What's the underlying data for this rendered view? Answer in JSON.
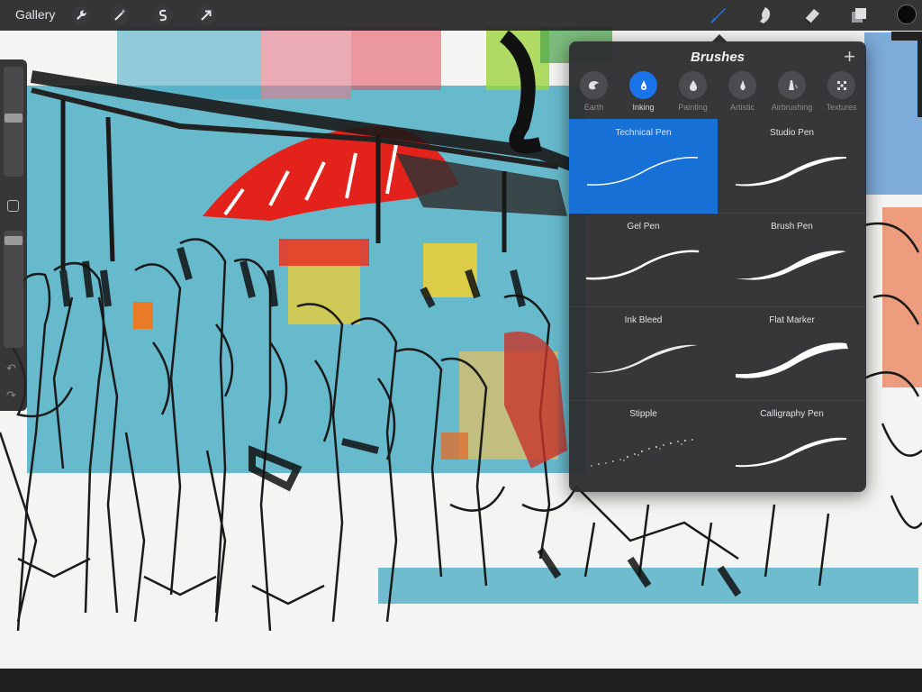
{
  "topbar": {
    "gallery_label": "Gallery",
    "tools_left": [
      "wrench-icon",
      "magic-wand-icon",
      "selection-s-icon",
      "arrow-move-icon"
    ],
    "tools_right": [
      "brush-icon",
      "smudge-icon",
      "eraser-icon",
      "layers-icon"
    ],
    "active_tool": "brush-icon",
    "current_color": "#0a0a0a"
  },
  "brushes_panel": {
    "title": "Brushes",
    "add_label": "+",
    "categories": [
      {
        "label": "Earth",
        "icon": "earth-icon"
      },
      {
        "label": "Inking",
        "icon": "ink-drop-icon",
        "active": true
      },
      {
        "label": "Painting",
        "icon": "paint-drop-icon"
      },
      {
        "label": "Artistic",
        "icon": "nib-icon"
      },
      {
        "label": "Airbrushing",
        "icon": "airbrush-icon"
      },
      {
        "label": "Textures",
        "icon": "texture-icon"
      }
    ],
    "brushes": [
      {
        "name": "Technical Pen",
        "selected": true
      },
      {
        "name": "Studio Pen"
      },
      {
        "name": "Gel Pen"
      },
      {
        "name": "Brush Pen"
      },
      {
        "name": "Ink Bleed"
      },
      {
        "name": "Flat Marker"
      },
      {
        "name": "Stipple"
      },
      {
        "name": "Calligraphy Pen"
      }
    ]
  },
  "colors": {
    "accent": "#1a73e8",
    "panel_bg": "#2c2c2e",
    "toolbar_bg": "#262628"
  }
}
